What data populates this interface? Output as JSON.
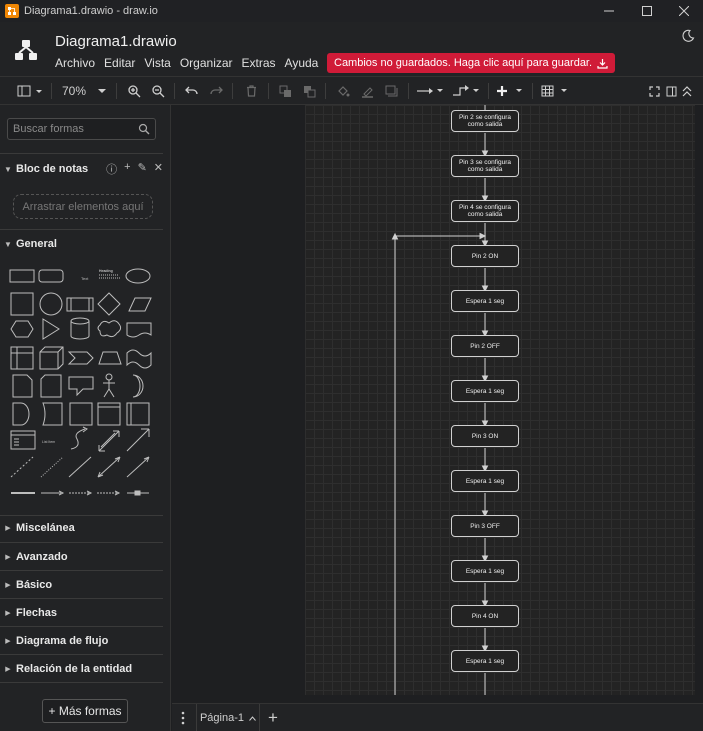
{
  "window": {
    "title": "Diagrama1.drawio - draw.io",
    "controls": [
      "minimize-icon",
      "maximize-icon",
      "close-icon"
    ]
  },
  "header": {
    "doc_title": "Diagrama1.drawio",
    "menu": [
      "Archivo",
      "Editar",
      "Vista",
      "Organizar",
      "Extras",
      "Ayuda"
    ],
    "unsaved_label": "Cambios no guardados. Haga clic aquí para guardar.",
    "unsaved_color": "#d01b38",
    "theme_icon": "moon-icon"
  },
  "toolbar": {
    "zoom": "70%",
    "icons": [
      "format-panel-icon",
      "zoom-in-icon",
      "zoom-out-icon",
      "undo-icon",
      "redo-icon",
      "delete-icon",
      "to-front-icon",
      "to-back-icon",
      "fill-color-icon",
      "line-color-icon",
      "shadow-icon",
      "connection-icon",
      "waypoints-icon",
      "insert-icon",
      "table-icon",
      "fullscreen-icon",
      "panels-icon",
      "collapse-icon"
    ]
  },
  "sidebar": {
    "search_placeholder": "Buscar formas",
    "scratchpad": {
      "title": "Bloc de notas",
      "drop_hint": "Arrastrar elementos aquí"
    },
    "general": {
      "title": "General"
    },
    "collapsed_sections": [
      "Miscelánea",
      "Avanzado",
      "Básico",
      "Flechas",
      "Diagrama de flujo",
      "Relación de la entidad"
    ],
    "more_shapes": "+ Más formas",
    "shape_labels": {
      "text": "Text",
      "heading": "Heading",
      "list_item": "List Item"
    }
  },
  "diagram": {
    "nodes": [
      "Pin 2 se configura como salida",
      "Pin 3 se configura como salida",
      "Pin 4 se configura como salida",
      "Pin 2 ON",
      "Espera 1 seg",
      "Pin 2 OFF",
      "Espera 1 seg",
      "Pin 3 ON",
      "Espera 1 seg",
      "Pin 3 OFF",
      "Espera 1 seg",
      "Pin 4 ON",
      "Espera 1 seg"
    ]
  },
  "bottombar": {
    "page_tab": "Página-1"
  }
}
